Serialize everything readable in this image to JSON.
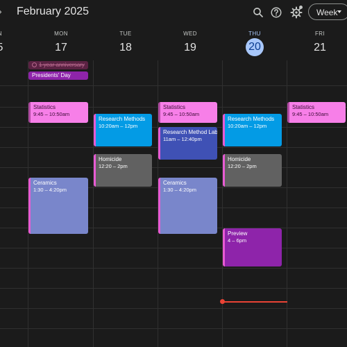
{
  "header": {
    "title": "February 2025",
    "view_label": "Week",
    "prev_glyph": "›"
  },
  "days": [
    {
      "dow": "N",
      "num": "5"
    },
    {
      "dow": "MON",
      "num": "17"
    },
    {
      "dow": "TUE",
      "num": "18"
    },
    {
      "dow": "WED",
      "num": "19"
    },
    {
      "dow": "THU",
      "num": "20"
    },
    {
      "dow": "FRI",
      "num": "21"
    }
  ],
  "all_day": [
    {
      "title": "1 year anniversary"
    },
    {
      "title": "Presidents' Day"
    }
  ],
  "events": {
    "mon_statistics": {
      "title": "Statistics",
      "time": "9:45 – 10:50am"
    },
    "mon_ceramics": {
      "title": "Ceramics",
      "time": "1:30 – 4:20pm"
    },
    "tue_research_methods": {
      "title": "Research Methods",
      "time": "10:20am – 12pm"
    },
    "tue_homicide": {
      "title": "Homicide",
      "time": "12:20 – 2pm"
    },
    "wed_statistics": {
      "title": "Statistics",
      "time": "9:45 – 10:50am"
    },
    "wed_research_method_lab": {
      "title": "Research Method Lab",
      "time": "11am – 12:40pm"
    },
    "wed_ceramics": {
      "title": "Ceramics",
      "time": "1:30 – 4:20pm"
    },
    "thu_research_methods": {
      "title": "Research Methods",
      "time": "10:20am – 12pm"
    },
    "thu_homicide": {
      "title": "Homicide",
      "time": "12:20 – 2pm"
    },
    "thu_preview": {
      "title": "Preview",
      "time": "4 – 6pm"
    },
    "fri_statistics": {
      "title": "Statistics",
      "time": "9:45 – 10:50am"
    }
  },
  "colors": {
    "today_accent": "#a8c7fa",
    "current_time_line": "#ea4335",
    "statistics": "#f77fe8",
    "research_methods": "#039be5",
    "research_method_lab": "#3f51b5",
    "homicide": "#616161",
    "ceramics": "#7986cb",
    "presidents_day": "#8e24aa"
  },
  "icons": [
    "chevron-right-icon",
    "search-icon",
    "help-icon",
    "gear-icon",
    "dropdown-caret-icon",
    "check-circle-icon"
  ]
}
